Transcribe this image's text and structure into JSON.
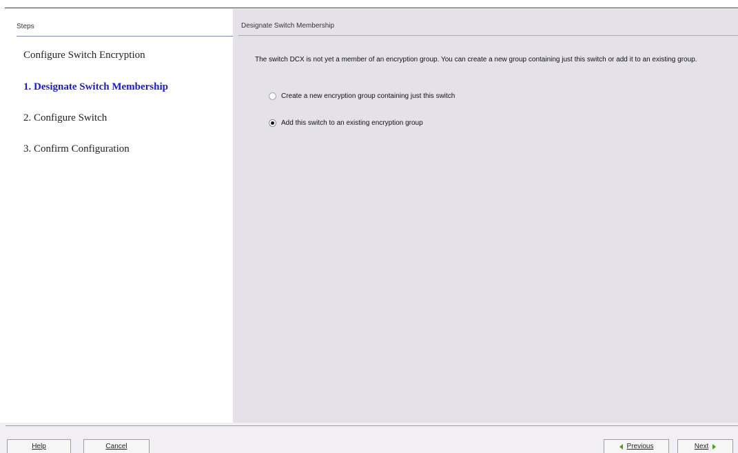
{
  "steps": {
    "header": "Steps",
    "title": "Configure Switch Encryption",
    "items": [
      {
        "label": "1. Designate Switch Membership"
      },
      {
        "label": "2. Configure Switch"
      },
      {
        "label": "3. Confirm Configuration"
      }
    ],
    "active_index": 0,
    "active_color": "#1a1ad0"
  },
  "content": {
    "header": "Designate Switch Membership",
    "description": "The switch DCX is not yet a member of an encryption group. You can create a new group containing just this switch or add it to an existing group.",
    "options": [
      {
        "label": "Create a new encryption group containing just this switch",
        "selected": false
      },
      {
        "label": "Add this switch to an existing encryption group",
        "selected": true
      }
    ]
  },
  "footer": {
    "help_label": "Help",
    "cancel_label": "Cancel",
    "previous_label": "Previous",
    "next_label": "Next"
  },
  "icons": {
    "previous": "arrow-left-icon",
    "next": "arrow-right-icon"
  }
}
